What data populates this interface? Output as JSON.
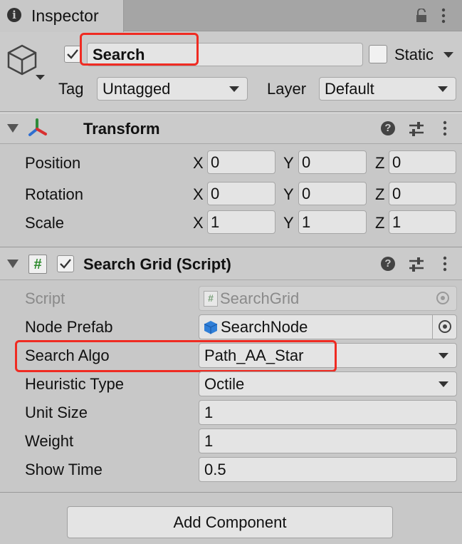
{
  "tab": {
    "title": "Inspector"
  },
  "gameobject": {
    "name": "Search",
    "static_label": "Static",
    "tag_label": "Tag",
    "tag_value": "Untagged",
    "layer_label": "Layer",
    "layer_value": "Default"
  },
  "transform": {
    "title": "Transform",
    "rows": [
      {
        "label": "Position",
        "x": "0",
        "y": "0",
        "z": "0"
      },
      {
        "label": "Rotation",
        "x": "0",
        "y": "0",
        "z": "0"
      },
      {
        "label": "Scale",
        "x": "1",
        "y": "1",
        "z": "1"
      }
    ],
    "axes": {
      "x": "X",
      "y": "Y",
      "z": "Z"
    }
  },
  "script_component": {
    "title": "Search Grid (Script)",
    "script_label": "Script",
    "script_value": "SearchGrid",
    "node_prefab_label": "Node Prefab",
    "node_prefab_value": "SearchNode",
    "search_algo_label": "Search Algo",
    "search_algo_value": "Path_AA_Star",
    "heuristic_label": "Heuristic Type",
    "heuristic_value": "Octile",
    "unit_size_label": "Unit Size",
    "unit_size_value": "1",
    "weight_label": "Weight",
    "weight_value": "1",
    "show_time_label": "Show Time",
    "show_time_value": "0.5"
  },
  "add_component": {
    "label": "Add Component"
  },
  "colors": {
    "highlight": "#ef2b22",
    "panel": "#c8c8c8",
    "header": "#cbcbcb",
    "field": "#e4e4e4",
    "prefab_blue": "#2f7fd8",
    "script_green": "#2b8a2b"
  }
}
